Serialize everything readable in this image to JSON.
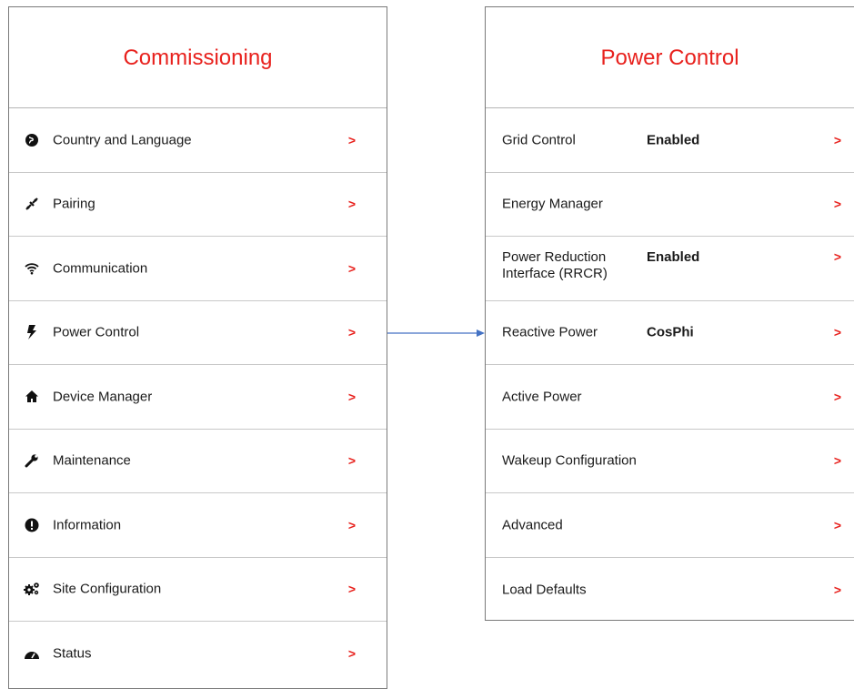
{
  "commissioning": {
    "title": "Commissioning",
    "items": [
      {
        "icon": "globe-icon",
        "label": "Country and Language",
        "chevron": ">"
      },
      {
        "icon": "pairing-icon",
        "label": "Pairing",
        "chevron": ">"
      },
      {
        "icon": "wifi-icon",
        "label": "Communication",
        "chevron": ">"
      },
      {
        "icon": "bolt-icon",
        "label": "Power Control",
        "chevron": ">"
      },
      {
        "icon": "home-icon",
        "label": "Device Manager",
        "chevron": ">"
      },
      {
        "icon": "wrench-icon",
        "label": "Maintenance",
        "chevron": ">"
      },
      {
        "icon": "info-icon",
        "label": "Information",
        "chevron": ">"
      },
      {
        "icon": "cogs-icon",
        "label": "Site Configuration",
        "chevron": ">"
      },
      {
        "icon": "gauge-icon",
        "label": "Status",
        "chevron": ">"
      }
    ]
  },
  "power_control": {
    "title": "Power Control",
    "items": [
      {
        "label": "Grid Control",
        "value": "Enabled",
        "chevron": ">"
      },
      {
        "label": "Energy Manager",
        "value": "",
        "chevron": ">"
      },
      {
        "label": "Power Reduction Interface (RRCR)",
        "value": "Enabled",
        "chevron": ">"
      },
      {
        "label": "Reactive Power",
        "value": "CosPhi",
        "chevron": ">"
      },
      {
        "label": "Active Power",
        "value": "",
        "chevron": ">"
      },
      {
        "label": "Wakeup Configuration",
        "value": "",
        "chevron": ">"
      },
      {
        "label": "Advanced",
        "value": "",
        "chevron": ">"
      },
      {
        "label": "Load Defaults",
        "value": "",
        "chevron": ">"
      }
    ]
  },
  "colors": {
    "accent": "#e8211d",
    "connector": "#4472c4"
  }
}
